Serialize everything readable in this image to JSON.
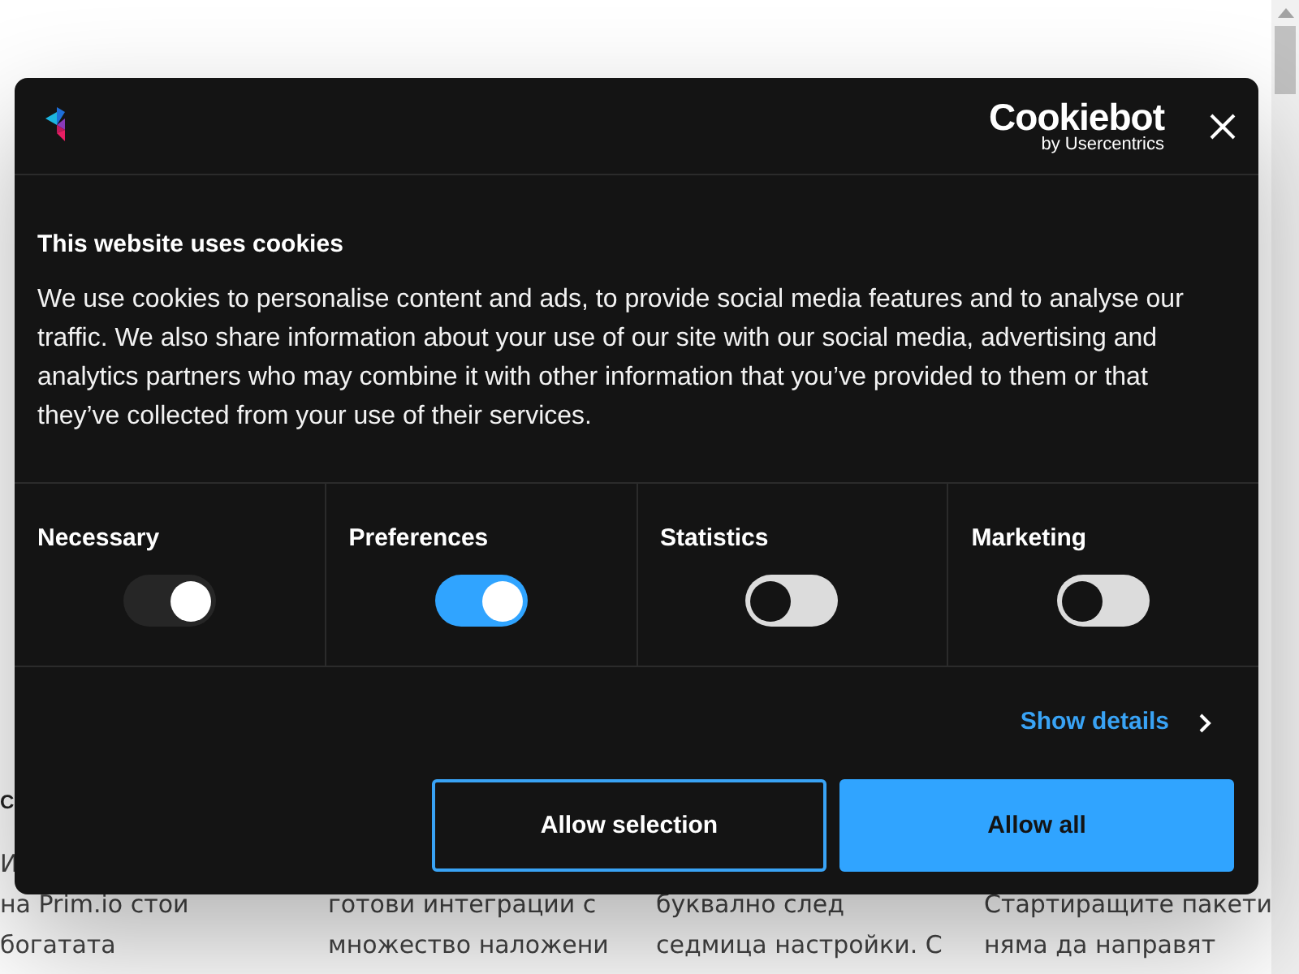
{
  "page": {
    "heading": "С",
    "columns": [
      {
        "lines": [
          "И",
          "на Prim.io стои",
          "богатата"
        ]
      },
      {
        "lines": [
          "готови интеграции с",
          "множество наложени"
        ]
      },
      {
        "lines": [
          "буквално след",
          "седмица настройки. С"
        ]
      },
      {
        "lines": [
          "Стартиращите пакети",
          "няма да направят"
        ]
      }
    ]
  },
  "dialog": {
    "brand": {
      "name": "Cookiebot",
      "by": "by Usercentrics"
    },
    "title": "This website uses cookies",
    "text": "We use cookies to personalise content and ads, to provide social media features and to analyse our traffic. We also share information about your use of our site with our social media, advertising and analytics partners who may combine it with other information that you’ve provided to them or that they’ve collected from your use of their services.",
    "categories": [
      {
        "label": "Necessary",
        "on": true,
        "disabled": true
      },
      {
        "label": "Preferences",
        "on": true,
        "disabled": false
      },
      {
        "label": "Statistics",
        "on": false,
        "disabled": false
      },
      {
        "label": "Marketing",
        "on": false,
        "disabled": false
      }
    ],
    "details_link": "Show details",
    "buttons": [
      {
        "label": "Allow selection",
        "kind": "outline"
      },
      {
        "label": "Allow all",
        "kind": "filled"
      }
    ]
  }
}
